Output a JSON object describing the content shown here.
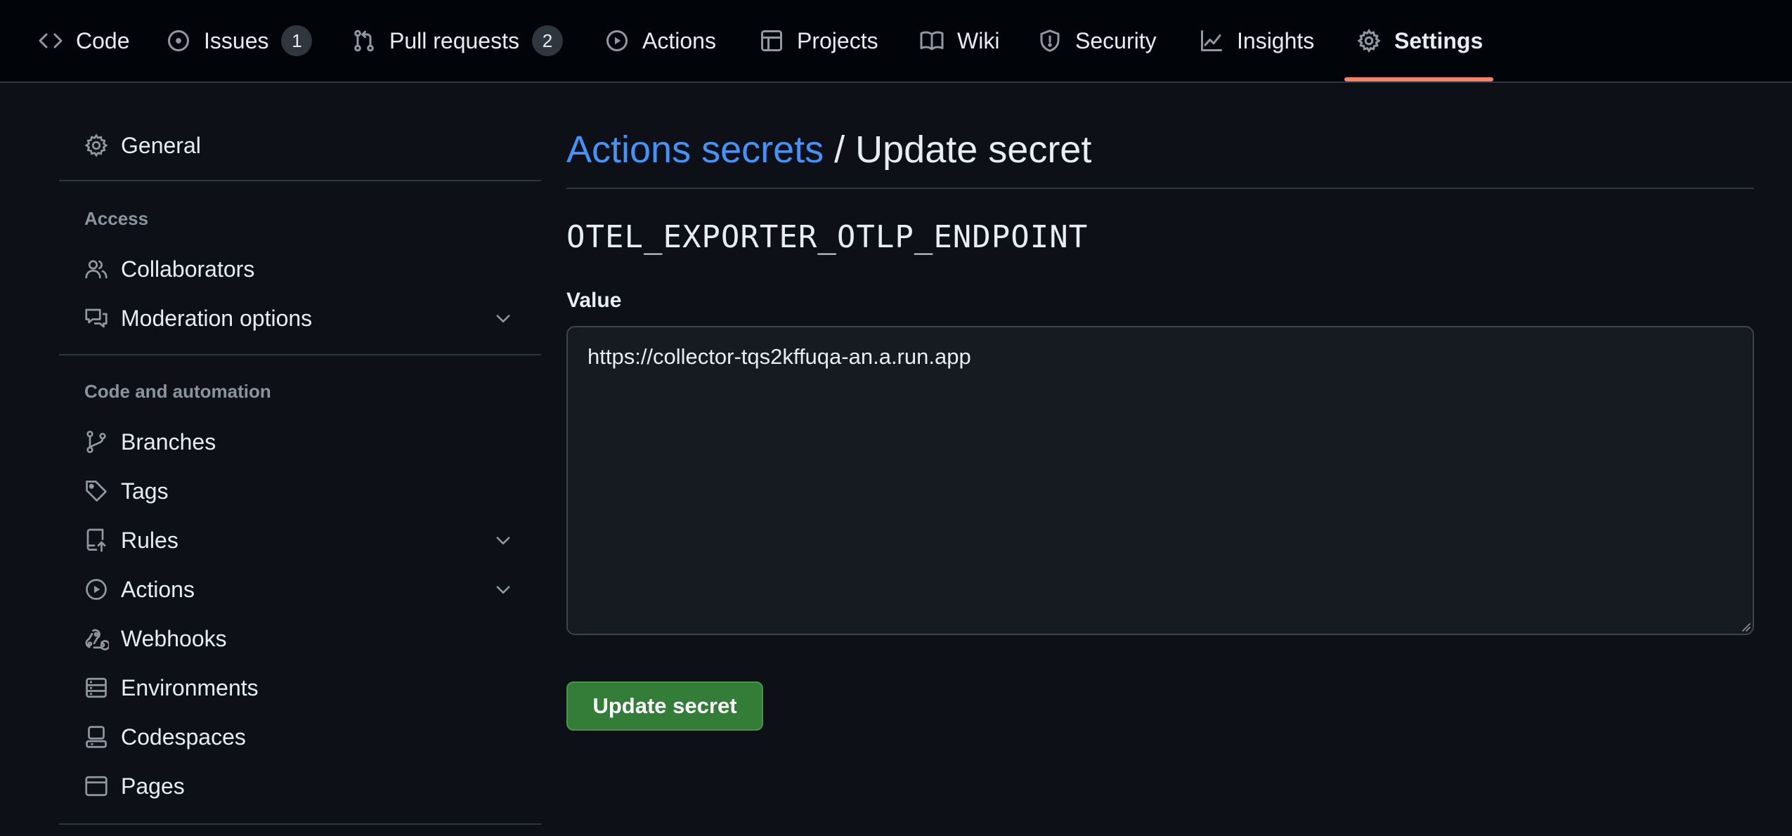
{
  "repo_nav": {
    "tabs": [
      {
        "label": "Code",
        "icon": "code-icon"
      },
      {
        "label": "Issues",
        "icon": "issue-opened-icon",
        "count": "1"
      },
      {
        "label": "Pull requests",
        "icon": "git-pull-request-icon",
        "count": "2"
      },
      {
        "label": "Actions",
        "icon": "play-icon"
      },
      {
        "label": "Projects",
        "icon": "table-icon"
      },
      {
        "label": "Wiki",
        "icon": "book-icon"
      },
      {
        "label": "Security",
        "icon": "shield-icon"
      },
      {
        "label": "Insights",
        "icon": "graph-icon"
      },
      {
        "label": "Settings",
        "icon": "gear-icon",
        "active": true
      }
    ]
  },
  "sidebar": {
    "general": "General",
    "access_heading": "Access",
    "access_items": [
      {
        "label": "Collaborators",
        "icon": "people-icon"
      },
      {
        "label": "Moderation options",
        "icon": "comment-discussion-icon",
        "expandable": true
      }
    ],
    "code_heading": "Code and automation",
    "code_items": [
      {
        "label": "Branches",
        "icon": "git-branch-icon"
      },
      {
        "label": "Tags",
        "icon": "tag-icon"
      },
      {
        "label": "Rules",
        "icon": "repo-push-icon",
        "expandable": true
      },
      {
        "label": "Actions",
        "icon": "play-icon",
        "expandable": true
      },
      {
        "label": "Webhooks",
        "icon": "webhook-icon"
      },
      {
        "label": "Environments",
        "icon": "server-icon"
      },
      {
        "label": "Codespaces",
        "icon": "codespaces-icon"
      },
      {
        "label": "Pages",
        "icon": "browser-icon"
      }
    ]
  },
  "main": {
    "breadcrumb_link": "Actions secrets",
    "title_rest": " / Update secret",
    "secret_name": "OTEL_EXPORTER_OTLP_ENDPOINT",
    "value_label": "Value",
    "value": "https://collector-tqs2kffuqa-an.a.run.app",
    "submit_label": "Update secret"
  },
  "colors": {
    "background": "#0d1117",
    "nav_background": "#010409",
    "link": "#4493f8",
    "active_underline": "#f78166",
    "button_green": "#347d39"
  }
}
